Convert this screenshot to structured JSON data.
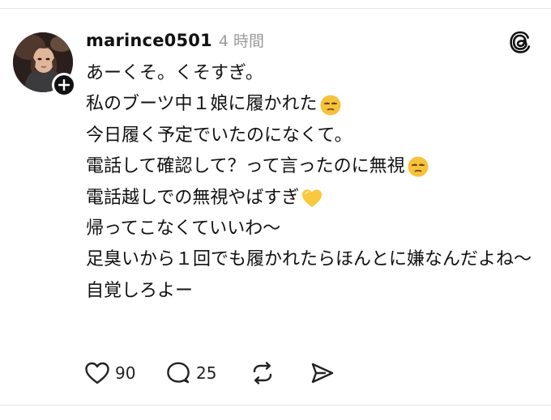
{
  "post": {
    "username": "marince0501",
    "timestamp": "4 時間",
    "lines": [
      "あーくそ。くそすぎ。",
      "私のブーツ中１娘に履かれた",
      "今日履く予定でいたのになくて。",
      "電話して確認して？って言ったのに無視",
      "電話越しでの無視やばすぎ",
      "帰ってこなくていいわ〜",
      "足臭いから１回でも履かれたらほんとに嫌なんだよね〜",
      "自覚しろよー"
    ],
    "emojis": {
      "line2": "unamused-face",
      "line4": "unamused-face",
      "line5": "yellow-heart"
    }
  },
  "actions": {
    "like_count": "90",
    "comment_count": "25",
    "like_icon": "heart-icon",
    "comment_icon": "comment-bubble-icon",
    "repost_icon": "repost-icon",
    "share_icon": "send-icon"
  },
  "icons": {
    "follow": "plus-icon",
    "app_logo": "threads-logo-icon"
  },
  "colors": {
    "text": "#111111",
    "muted": "#9a9a9a",
    "emoji_face": "#f7c23a",
    "heart": "#f8c93e"
  }
}
